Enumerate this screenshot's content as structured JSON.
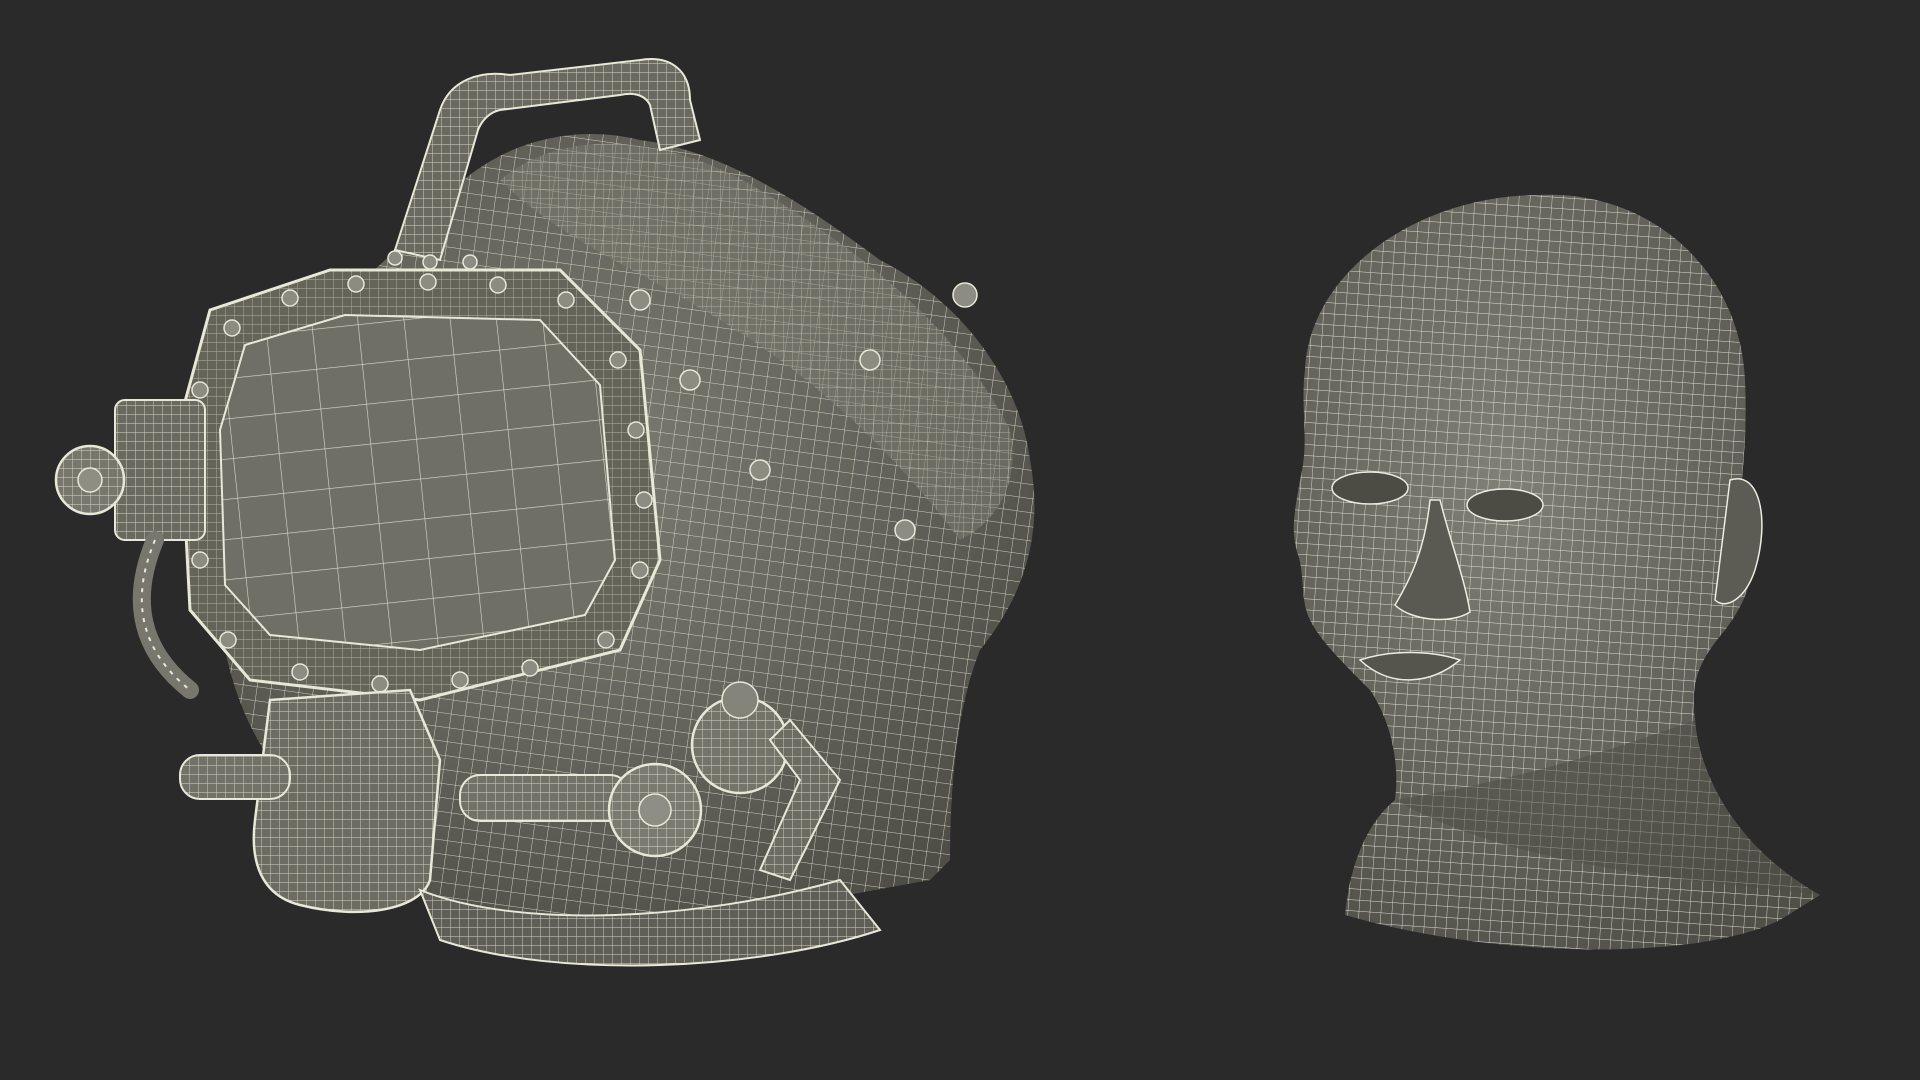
{
  "scene": {
    "background_color": "#2a2a2a",
    "wire_color": "#e8e8d8",
    "surface_color": "#6e6e64",
    "surface_dark": "#55554d",
    "objects": [
      {
        "name": "diving-helmet",
        "render": "wireframe-on-shaded"
      },
      {
        "name": "human-head",
        "render": "wireframe-on-shaded"
      }
    ]
  }
}
